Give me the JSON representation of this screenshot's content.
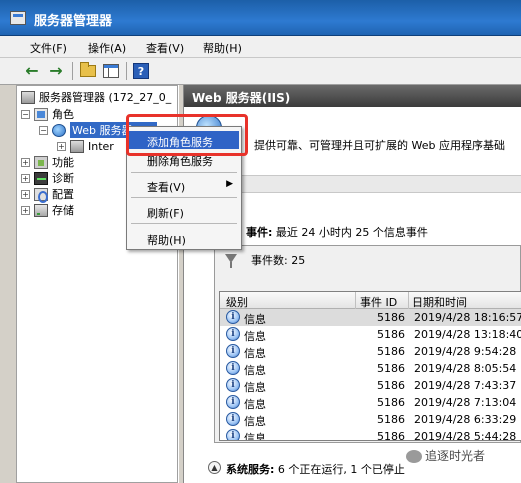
{
  "window": {
    "title": "服务器管理器"
  },
  "menu": {
    "file": "文件(F)",
    "action": "操作(A)",
    "view": "查看(V)",
    "help": "帮助(H)"
  },
  "toolbar": {
    "back_icon": "back-arrow-icon",
    "forward_icon": "forward-arrow-icon",
    "help_glyph": "?"
  },
  "tree": {
    "root": "服务器管理器 (172_27_0_",
    "roles": "角色",
    "web": "Web 服务器(IIS)",
    "inter": "Inter",
    "features": "功能",
    "diagnostics": "诊断",
    "configuration": "配置",
    "storage": "存储"
  },
  "right": {
    "header": "Web 服务器(IIS)",
    "description": "提供可靠、可管理并且可扩展的 Web 应用程序基础",
    "events_title": "事件:",
    "events_summary": "最近 24 小时内 25 个信息事件",
    "event_count": "事件数: 25",
    "columns": {
      "level": "级别",
      "event_id": "事件 ID",
      "datetime": "日期和时间"
    },
    "rows": [
      {
        "level": "信息",
        "id": "5186",
        "time": "2019/4/28 18:16:57"
      },
      {
        "level": "信息",
        "id": "5186",
        "time": "2019/4/28 13:18:40"
      },
      {
        "level": "信息",
        "id": "5186",
        "time": "2019/4/28 9:54:28"
      },
      {
        "level": "信息",
        "id": "5186",
        "time": "2019/4/28 8:05:54"
      },
      {
        "level": "信息",
        "id": "5186",
        "time": "2019/4/28 7:43:37"
      },
      {
        "level": "信息",
        "id": "5186",
        "time": "2019/4/28 7:13:04"
      },
      {
        "level": "信息",
        "id": "5186",
        "time": "2019/4/28 6:33:29"
      },
      {
        "level": "信息",
        "id": "5186",
        "time": "2019/4/28 5:44:28"
      }
    ],
    "system_services_title": "系统服务:",
    "system_services_summary": "6 个正在运行, 1 个已停止"
  },
  "context_menu": {
    "add_role_services": "添加角色服务",
    "remove_role_services": "删除角色服务",
    "view": "查看(V)",
    "refresh": "刷新(F)",
    "help": "帮助(H)"
  },
  "watermark": "追逐时光者",
  "colors": {
    "accent": "#2f63c6",
    "callout": "#e8322a",
    "title_bar": "#1c5fa8"
  }
}
